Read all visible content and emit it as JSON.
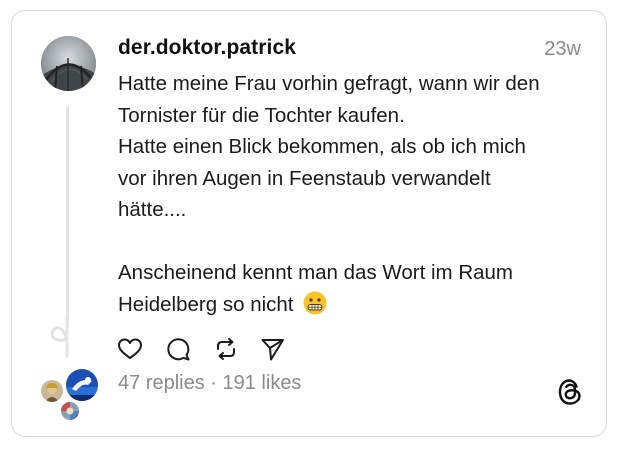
{
  "post": {
    "username": "der.doktor.patrick",
    "time": "23w",
    "lines": [
      "Hatte meine Frau vorhin gefragt, wann wir den",
      "Tornister für die Tochter kaufen.",
      "Hatte einen Blick bekommen, als ob ich mich",
      "vor ihren Augen in Feenstaub verwandelt",
      "hätte....",
      "",
      "Anscheinend kennt man das Wort im Raum",
      "Heidelberg so nicht"
    ],
    "emoji": "grimacing-face"
  },
  "stats": {
    "replies": "47 replies",
    "separator": " · ",
    "likes": "191 likes"
  },
  "icons": {
    "like": "heart-icon",
    "reply": "speech-bubble-icon",
    "repost": "repost-icon",
    "share": "send-icon",
    "brand": "threads-logo-icon"
  },
  "colors": {
    "text": "#1b1b1b",
    "muted": "#8b8b8b",
    "border": "#d9d9d9",
    "thread_line": "#e3e3e3"
  }
}
